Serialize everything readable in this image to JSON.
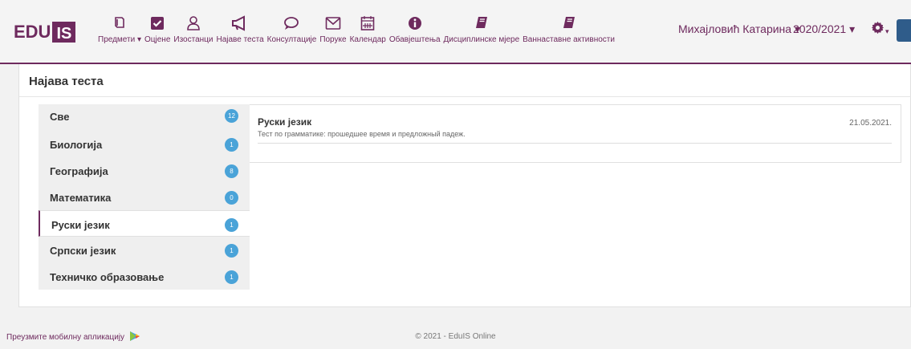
{
  "app": {
    "logo_left": "EDU",
    "logo_right": "IS",
    "brand_color": "#6e2a5e",
    "badge_color": "#4aa3d8"
  },
  "nav": [
    {
      "label": "Предмети",
      "icon": "books-icon",
      "has_dropdown": true
    },
    {
      "label": "Оцјене",
      "icon": "checkbox-icon"
    },
    {
      "label": "Изостанци",
      "icon": "user-icon"
    },
    {
      "label": "Најаве теста",
      "icon": "bullhorn-icon"
    },
    {
      "label": "Консултације",
      "icon": "chat-icon"
    },
    {
      "label": "Поруке",
      "icon": "envelope-icon"
    },
    {
      "label": "Календар",
      "icon": "calendar-icon"
    },
    {
      "label": "Обавјештења",
      "icon": "info-icon"
    },
    {
      "label": "Дисциплинске мјере",
      "icon": "book-icon"
    },
    {
      "label": "Ваннаставне активности",
      "icon": "book-icon"
    }
  ],
  "user": {
    "name": "Михајловић Катарина",
    "year": "2020/2021",
    "caret": "▾"
  },
  "page": {
    "title": "Најава теста"
  },
  "subjects": [
    {
      "name": "Све",
      "count": "12"
    },
    {
      "name": "Биологија",
      "count": "1"
    },
    {
      "name": "Географија",
      "count": "8"
    },
    {
      "name": "Математика",
      "count": "0"
    },
    {
      "name": "Руски језик",
      "count": "1",
      "active": true
    },
    {
      "name": "Српски језик",
      "count": "1"
    },
    {
      "name": "Техничко образовање",
      "count": "1"
    }
  ],
  "entry": {
    "subject": "Руски језик",
    "description": "Тест по грамматике: прошедшее время и предложный падеж.",
    "date": "21.05.2021."
  },
  "footer": {
    "app_link": "Преузмите мобилну апликацију",
    "copyright": "© 2021 - EduIS Online"
  }
}
